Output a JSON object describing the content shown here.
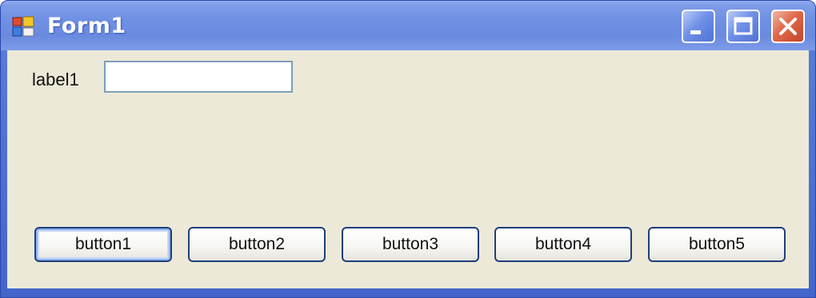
{
  "window": {
    "title": "Form1",
    "controls": {
      "minimize": "minimize-icon",
      "maximize": "maximize-icon",
      "close": "close-icon"
    }
  },
  "form": {
    "label1": "label1",
    "textbox1": {
      "value": "",
      "placeholder": ""
    },
    "buttons": [
      "button1",
      "button2",
      "button3",
      "button4",
      "button5"
    ],
    "focused_button": "button1"
  },
  "colors": {
    "titlebar": "#6f8fe3",
    "client_background": "#ece9d8",
    "button_border": "#1e3f7a",
    "close_button": "#e0684a"
  }
}
